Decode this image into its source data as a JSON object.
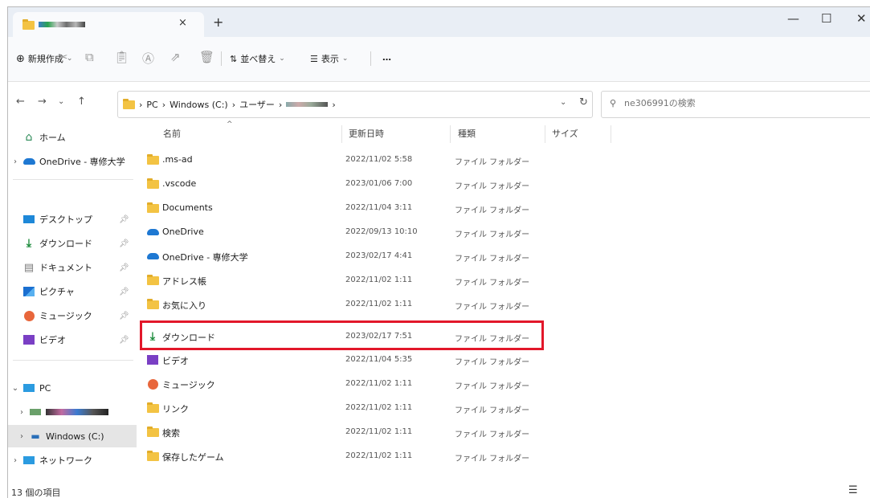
{
  "window": {
    "tab_title": "",
    "new_tab": "+",
    "tab_close": "×",
    "min": "—",
    "max": "☐",
    "close": "✕"
  },
  "toolbar": {
    "new_label": "新規作成",
    "sort_label": "並べ替え",
    "view_label": "表示",
    "more_label": "…"
  },
  "address": {
    "crumbs": [
      "PC",
      "Windows (C:)",
      "ユーザー",
      ""
    ],
    "search_placeholder": "ne306991の検索"
  },
  "sidebar": {
    "items": [
      {
        "label": "ホーム",
        "icon": "home-icon"
      },
      {
        "label": "OneDrive - 専修大学",
        "icon": "onedrive-icon"
      },
      {
        "label": "デスクトップ",
        "icon": "desktop-icon"
      },
      {
        "label": "ダウンロード",
        "icon": "download-icon"
      },
      {
        "label": "ドキュメント",
        "icon": "document-icon"
      },
      {
        "label": "ピクチャ",
        "icon": "pictures-icon"
      },
      {
        "label": "ミュージック",
        "icon": "music-icon"
      },
      {
        "label": "ビデオ",
        "icon": "video-icon"
      },
      {
        "label": "PC",
        "icon": "pc-icon"
      },
      {
        "label": "",
        "icon": "network-drive-icon"
      },
      {
        "label": "Windows (C:)",
        "icon": "drive-icon"
      },
      {
        "label": "ネットワーク",
        "icon": "network-icon"
      }
    ]
  },
  "columns": {
    "name": "名前",
    "date": "更新日時",
    "type": "種類",
    "size": "サイズ"
  },
  "files": [
    {
      "name": ".ms-ad",
      "date": "2022/11/02 5:58",
      "type": "ファイル フォルダー",
      "icon": "folder-icon"
    },
    {
      "name": ".vscode",
      "date": "2023/01/06 7:00",
      "type": "ファイル フォルダー",
      "icon": "folder-icon"
    },
    {
      "name": "Documents",
      "date": "2022/11/04 3:11",
      "type": "ファイル フォルダー",
      "icon": "folder-icon"
    },
    {
      "name": "OneDrive",
      "date": "2022/09/13 10:10",
      "type": "ファイル フォルダー",
      "icon": "onedrive-icon"
    },
    {
      "name": "OneDrive - 専修大学",
      "date": "2023/02/17 4:41",
      "type": "ファイル フォルダー",
      "icon": "onedrive-icon"
    },
    {
      "name": "アドレス帳",
      "date": "2022/11/02 1:11",
      "type": "ファイル フォルダー",
      "icon": "folder-icon"
    },
    {
      "name": "お気に入り",
      "date": "2022/11/02 1:11",
      "type": "ファイル フォルダー",
      "icon": "folder-icon"
    },
    {
      "name": "ダウンロード",
      "date": "2023/02/17 7:51",
      "type": "ファイル フォルダー",
      "icon": "download-icon"
    },
    {
      "name": "ビデオ",
      "date": "2022/11/04 5:35",
      "type": "ファイル フォルダー",
      "icon": "video-icon"
    },
    {
      "name": "ミュージック",
      "date": "2022/11/02 1:11",
      "type": "ファイル フォルダー",
      "icon": "music-icon"
    },
    {
      "name": "リンク",
      "date": "2022/11/02 1:11",
      "type": "ファイル フォルダー",
      "icon": "folder-icon"
    },
    {
      "name": "検索",
      "date": "2022/11/02 1:11",
      "type": "ファイル フォルダー",
      "icon": "folder-icon"
    },
    {
      "name": "保存したゲーム",
      "date": "2022/11/02 1:11",
      "type": "ファイル フォルダー",
      "icon": "folder-icon"
    }
  ],
  "status": {
    "count_text": "13 個の項目"
  },
  "colors": {
    "highlight": "#e2172a",
    "folder": "#f3c343",
    "onedrive": "#1e78d2",
    "download": "#1a8a3a"
  }
}
